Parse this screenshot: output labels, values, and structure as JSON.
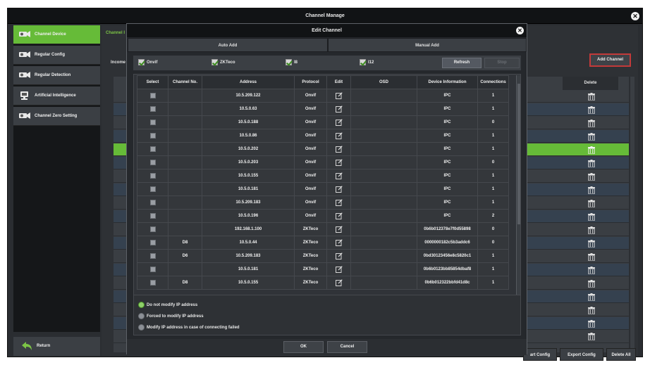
{
  "window": {
    "title": "Channel Manage"
  },
  "sidebar": {
    "items": [
      {
        "label": "Channel Device"
      },
      {
        "label": "Regular Config"
      },
      {
        "label": "Regular Detection"
      },
      {
        "label": "Artificial Intelligence"
      },
      {
        "label": "Channel Zero Setting"
      }
    ],
    "return_label": "Return"
  },
  "main": {
    "tab_label": "Channel I",
    "income_label": "Income",
    "add_channel_label": "Add Channel",
    "delete_header": "Delete",
    "import_label": "art Config",
    "export_label": "Export Config",
    "delete_all_label": "Delete All"
  },
  "dialog": {
    "title": "Edit Channel",
    "tabs": [
      {
        "label": "Auto Add"
      },
      {
        "label": "Manual Add"
      }
    ],
    "filters": [
      {
        "label": "Onvif",
        "checked": true
      },
      {
        "label": "ZKTeco",
        "checked": true
      },
      {
        "label": "I8",
        "checked": true
      },
      {
        "label": "I12",
        "checked": true
      }
    ],
    "refresh_label": "Refresh",
    "stop_label": "Stop",
    "columns": [
      "Select",
      "Channel No.",
      "Address",
      "Protocol",
      "Edit",
      "OSD",
      "Device Information",
      "Connections"
    ],
    "rows": [
      {
        "channel": "",
        "address": "10.5.209.122",
        "protocol": "Onvif",
        "osd": "",
        "info": "IPC",
        "conn": "1"
      },
      {
        "channel": "",
        "address": "10.5.0.63",
        "protocol": "Onvif",
        "osd": "",
        "info": "IPC",
        "conn": "1"
      },
      {
        "channel": "",
        "address": "10.5.0.188",
        "protocol": "Onvif",
        "osd": "",
        "info": "IPC",
        "conn": "0"
      },
      {
        "channel": "",
        "address": "10.5.0.86",
        "protocol": "Onvif",
        "osd": "",
        "info": "IPC",
        "conn": "1"
      },
      {
        "channel": "",
        "address": "10.5.0.202",
        "protocol": "Onvif",
        "osd": "",
        "info": "IPC",
        "conn": "1"
      },
      {
        "channel": "",
        "address": "10.5.0.203",
        "protocol": "Onvif",
        "osd": "",
        "info": "IPC",
        "conn": "0"
      },
      {
        "channel": "",
        "address": "10.5.0.155",
        "protocol": "Onvif",
        "osd": "",
        "info": "IPC",
        "conn": "1"
      },
      {
        "channel": "",
        "address": "10.5.0.181",
        "protocol": "Onvif",
        "osd": "",
        "info": "IPC",
        "conn": "1"
      },
      {
        "channel": "",
        "address": "10.5.209.183",
        "protocol": "Onvif",
        "osd": "",
        "info": "IPC",
        "conn": "1"
      },
      {
        "channel": "",
        "address": "10.5.0.196",
        "protocol": "Onvif",
        "osd": "",
        "info": "IPC",
        "conn": "2"
      },
      {
        "channel": "",
        "address": "192.168.1.100",
        "protocol": "ZKTeco",
        "osd": "",
        "info": "0b6b012378e7f0d55898",
        "conn": "0"
      },
      {
        "channel": "D8",
        "address": "10.5.0.44",
        "protocol": "ZKTeco",
        "osd": "",
        "info": "0000000182c5b3addc6",
        "conn": "0"
      },
      {
        "channel": "D6",
        "address": "10.5.209.183",
        "protocol": "ZKTeco",
        "osd": "",
        "info": "0bd30123456e8c5820c1",
        "conn": "1"
      },
      {
        "channel": "",
        "address": "10.5.0.181",
        "protocol": "ZKTeco",
        "osd": "",
        "info": "0b6b0123bb85854dbaf8",
        "conn": "1"
      },
      {
        "channel": "D8",
        "address": "10.5.0.155",
        "protocol": "ZKTeco",
        "osd": "",
        "info": "0b6b012322bbfd41d8c",
        "conn": "1"
      }
    ],
    "options": [
      {
        "label": "Do not modify IP address",
        "selected": true
      },
      {
        "label": "Forced to modify IP address",
        "selected": false
      },
      {
        "label": "Modify IP address in case of connecting failed",
        "selected": false
      }
    ],
    "ok_label": "OK",
    "cancel_label": "Cancel"
  },
  "colors": {
    "accent_green": "#66bb38",
    "highlight_red": "#c23a3a",
    "title_bar": "#111315"
  }
}
